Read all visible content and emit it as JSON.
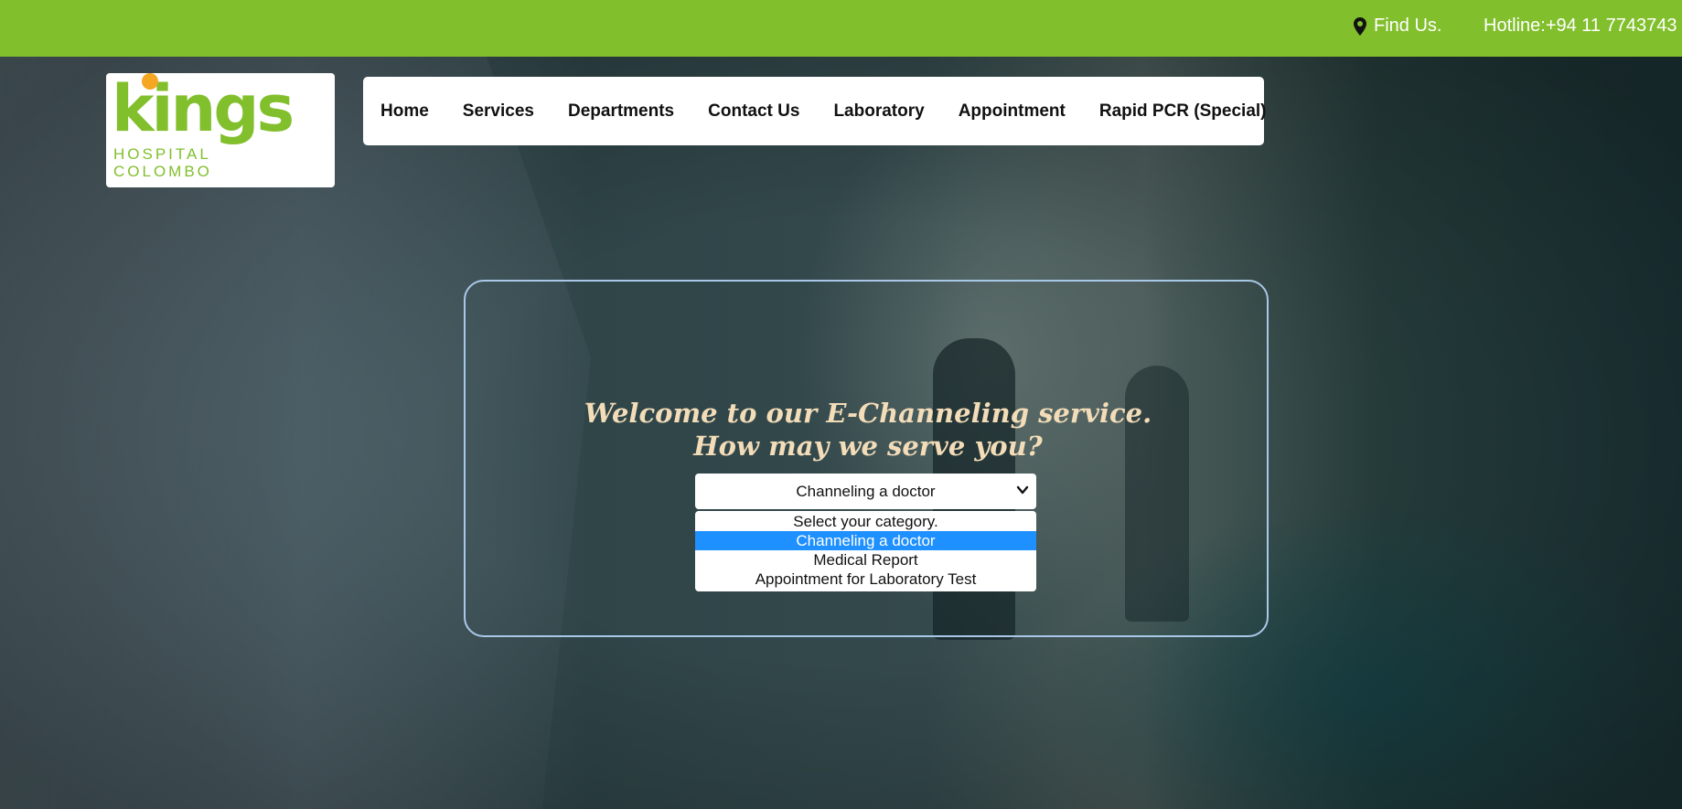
{
  "topbar": {
    "find_us": "Find Us.",
    "hotline": "Hotline:+94 11 7743743",
    "location_icon": "map-pin-icon"
  },
  "logo": {
    "word": "kings",
    "line1": "HOSPITAL",
    "line2": "COLOMBO"
  },
  "nav": {
    "items": [
      {
        "label": "Home"
      },
      {
        "label": "Services"
      },
      {
        "label": "Departments"
      },
      {
        "label": "Contact Us"
      },
      {
        "label": "Laboratory"
      },
      {
        "label": "Appointment"
      },
      {
        "label": "Rapid PCR (Special)"
      }
    ]
  },
  "main": {
    "welcome_line1": "Welcome to our E-Channeling service.",
    "welcome_line2": "How may we serve you?",
    "category_select": {
      "selected_value": "Channeling a doctor",
      "options": [
        {
          "label": "Select your category."
        },
        {
          "label": "Channeling a doctor"
        },
        {
          "label": "Medical Report"
        },
        {
          "label": "Appointment for Laboratory Test"
        }
      ],
      "highlighted_option": "Channeling a doctor"
    }
  },
  "colors": {
    "brand_green": "#82bf2d",
    "logo_dot_orange": "#f5a623",
    "welcome_text": "#f3dcb8",
    "panel_border": "#a9c8e8",
    "highlight_blue": "#1e90ff"
  }
}
